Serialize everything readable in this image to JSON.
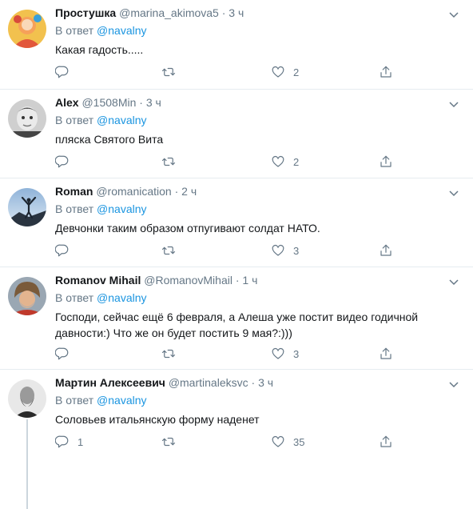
{
  "tweets": [
    {
      "name": "Простушка",
      "handle": "@marina_akimova5",
      "dot": "·",
      "time": "3 ч",
      "reply_prefix": "В ответ",
      "reply_to": "@navalny",
      "text": "Какая гадость.....",
      "replies": "",
      "retweets": "",
      "likes": "2"
    },
    {
      "name": "Alex",
      "handle": "@1508Min",
      "dot": "·",
      "time": "3 ч",
      "reply_prefix": "В ответ",
      "reply_to": "@navalny",
      "text": "пляска Святого Вита",
      "replies": "",
      "retweets": "",
      "likes": "2"
    },
    {
      "name": "Roman",
      "handle": "@romanication",
      "dot": "·",
      "time": "2 ч",
      "reply_prefix": "В ответ",
      "reply_to": "@navalny",
      "text": "Девчонки таким образом отпугивают солдат НАТО.",
      "replies": "",
      "retweets": "",
      "likes": "3"
    },
    {
      "name": "Romanov Mihail",
      "handle": "@RomanovMihail",
      "dot": "·",
      "time": "1 ч",
      "reply_prefix": "В ответ",
      "reply_to": "@navalny",
      "text": "Господи, сейчас ещё 6 февраля, а Алеша уже постит видео годичной давности:) Что же он будет постить 9 мая?:)))",
      "replies": "",
      "retweets": "",
      "likes": "3"
    },
    {
      "name": "Мартин Алексеевич",
      "handle": "@martinaleksvc",
      "dot": "·",
      "time": "3 ч",
      "reply_prefix": "В ответ",
      "reply_to": "@navalny",
      "text": "Соловьев итальянскую форму наденет",
      "replies": "1",
      "retweets": "",
      "likes": "35"
    }
  ],
  "colors": {
    "accent": "#1b95e0",
    "muted": "#657786",
    "text": "#14171a",
    "divider": "#e6ecf0"
  },
  "icons": [
    "avatar",
    "chevron-down-icon",
    "reply-icon",
    "retweet-icon",
    "like-icon",
    "share-icon"
  ]
}
